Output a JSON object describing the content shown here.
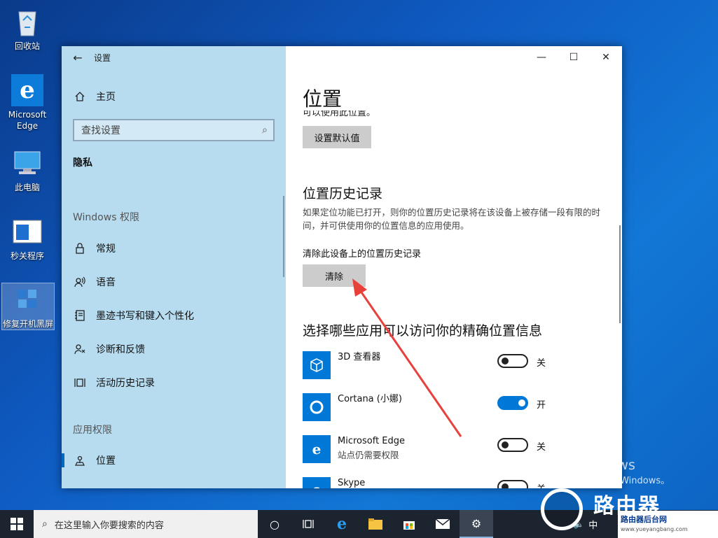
{
  "desktop": {
    "icons": [
      {
        "label": "回收站",
        "icon": "recycle-bin-icon"
      },
      {
        "label": "Microsoft Edge",
        "icon": "edge-icon"
      },
      {
        "label": "此电脑",
        "icon": "computer-icon"
      },
      {
        "label": "秒关程序",
        "icon": "program-icon"
      },
      {
        "label": "修复开机黑屏",
        "icon": "repair-tool-icon"
      }
    ]
  },
  "window": {
    "app_title": "设置",
    "back_icon": "back-arrow-icon",
    "controls": {
      "minimize": "—",
      "maximize": "☐",
      "close": "✕"
    }
  },
  "nav": {
    "home": "主页",
    "search_placeholder": "查找设置",
    "group_heading": "隐私",
    "windows_section": "Windows 权限",
    "windows_items": [
      "常规",
      "语音",
      "墨迹书写和键入个性化",
      "诊断和反馈",
      "活动历史记录"
    ],
    "app_section": "应用权限",
    "app_items": [
      "位置"
    ],
    "active_item": "位置"
  },
  "content": {
    "page_title": "位置",
    "clipped_text": "可以使用此位置。",
    "default_button": "设置默认值",
    "history_heading": "位置历史记录",
    "history_desc": "如果定位功能已打开，则你的位置历史记录将在该设备上被存储一段有限的时间，并可供使用你的位置信息的应用使用。",
    "clear_label": "清除此设备上的位置历史记录",
    "clear_button": "清除",
    "apps_heading": "选择哪些应用可以访问你的精确位置信息",
    "apps": [
      {
        "name": "3D 查看器",
        "sub": "",
        "state": "关",
        "on": false,
        "icon": "cube-icon"
      },
      {
        "name": "Cortana (小娜)",
        "sub": "",
        "state": "开",
        "on": true,
        "icon": "cortana-ring-icon"
      },
      {
        "name": "Microsoft Edge",
        "sub": "站点仍需要权限",
        "state": "关",
        "on": false,
        "icon": "edge-e-icon"
      },
      {
        "name": "Skype",
        "sub": "",
        "state": "关",
        "on": false,
        "icon": "skype-icon"
      }
    ]
  },
  "watermark": {
    "line1": "激活 Windows",
    "line2": "转到\"设置\"以激活 Windows。"
  },
  "taskbar": {
    "search_placeholder": "在这里输入你要搜索的内容",
    "icons": [
      "task-view-icon",
      "timeline-icon",
      "edge-icon",
      "file-explorer-icon",
      "store-icon",
      "mail-icon",
      "settings-icon"
    ],
    "tray_text": "中"
  },
  "logo": {
    "main": "路由器",
    "sub": "路由器后台网",
    "url": "www.yueyangbang.com"
  },
  "colors": {
    "accent": "#0078d7",
    "nav_bg": "#b7dcf0",
    "annotation_arrow": "#e8413c"
  }
}
